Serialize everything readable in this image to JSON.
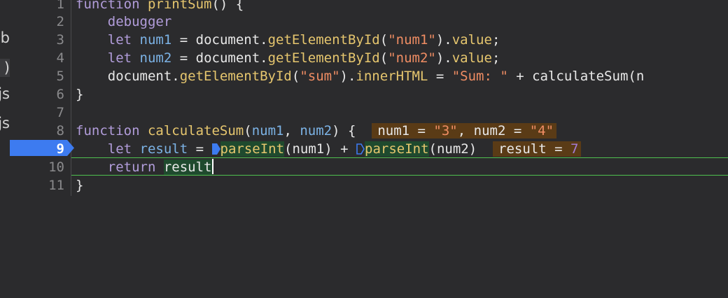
{
  "sidebar": {
    "tabs": [
      {
        "label": "ab",
        "selected": false
      },
      {
        "label": ")",
        "selected": true
      },
      {
        "label": "js",
        "selected": false
      },
      {
        "label": "js",
        "selected": false
      }
    ]
  },
  "editor": {
    "line_numbers": [
      "1",
      "2",
      "3",
      "4",
      "5",
      "6",
      "7",
      "8",
      "9",
      "10",
      "11"
    ],
    "active_line": "9",
    "breakpoint_color": "#3d7bf0",
    "line1": {
      "kw": "function",
      "fn": "printSum",
      "rest": "() {"
    },
    "line2": {
      "kw": "debugger"
    },
    "line3": {
      "kw": "let",
      "var": "num1",
      "eq": " = ",
      "obj": "document.",
      "fn": "getElementById",
      "p1": "(",
      "str": "\"num1\"",
      "p2": ").",
      "prop": "value",
      "end": ";"
    },
    "line4": {
      "kw": "let",
      "var": "num2",
      "eq": " = ",
      "obj": "document.",
      "fn": "getElementById",
      "p1": "(",
      "str": "\"num2\"",
      "p2": ").",
      "prop": "value",
      "end": ";"
    },
    "line5": {
      "obj": "document.",
      "fn": "getElementById",
      "p1": "(",
      "str": "\"sum\"",
      "p2": ").",
      "prop": "innerHTML",
      "eq": " = ",
      "str2": "\"Sum: \"",
      "plus": " + ",
      "call": "calculateSum(n"
    },
    "line6": {
      "text": "}"
    },
    "line8": {
      "kw": "function",
      "fn": "calculateSum",
      "p1": "(",
      "a1": "num1",
      "comma": ", ",
      "a2": "num2",
      "p2": ") {",
      "inline_a": "num1 = ",
      "inline_a_val": "\"3\"",
      "inline_sep": ", num2 = ",
      "inline_b_val": "\"4\""
    },
    "line9": {
      "kw": "let",
      "var": "result",
      "eq": " = ",
      "fn1": "parseInt",
      "arg1": "(num1)",
      "plus": " + ",
      "fn2": "parseInt",
      "arg2": "(num2)",
      "inline": "result = ",
      "inline_val": "7"
    },
    "line10": {
      "kw": "return",
      "var": "result"
    },
    "line11": {
      "text": "}"
    }
  }
}
